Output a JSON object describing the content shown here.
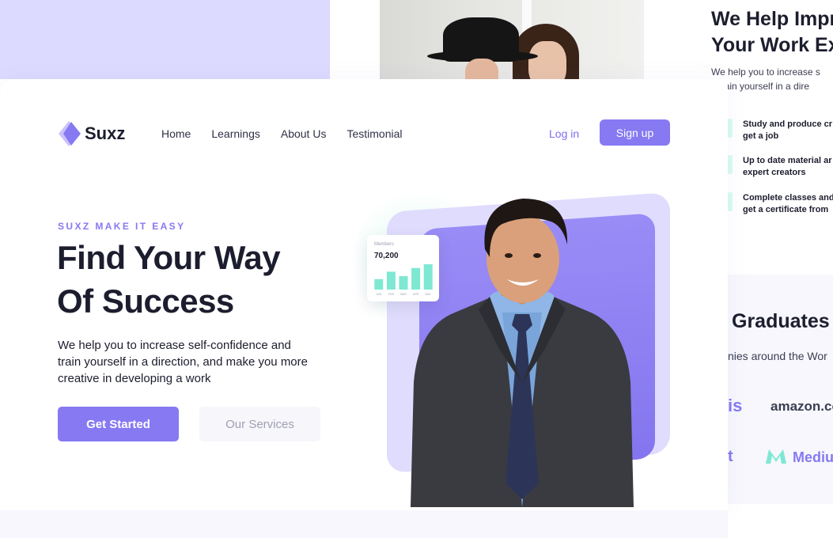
{
  "brand": {
    "name": "Suxz",
    "accent": "#8779f2",
    "mint": "#7ee8d2"
  },
  "nav": {
    "items": [
      {
        "label": "Home"
      },
      {
        "label": "Learnings"
      },
      {
        "label": "About Us"
      },
      {
        "label": "Testimonial"
      }
    ],
    "login_label": "Log in",
    "signup_label": "Sign up"
  },
  "hero": {
    "eyebrow": "SUXZ MAKE IT EASY",
    "headline": "Find Your Way\nOf Success",
    "description": "We help you to increase self-confidence and\ntrain yourself in a direction, and make you more\ncreative in developing a work",
    "primary_cta": "Get Started",
    "secondary_cta": "Our Services"
  },
  "stats_card": {
    "label": "Members",
    "value": "70,200",
    "chart_data": {
      "type": "bar",
      "categories": [
        "JAN",
        "FEB",
        "MAR",
        "APR",
        "MAY"
      ],
      "values": [
        14,
        24,
        18,
        29,
        34
      ],
      "color": "#7ee8d2"
    }
  },
  "right_page": {
    "title": "We Help Impr\nYour Work Exp",
    "description": "We help you to increase s\n’t train yourself in a dire",
    "features": [
      {
        "text": "Study and produce cr\nget a job"
      },
      {
        "text": "Up to date material ar\nexpert creators"
      },
      {
        "text": "Complete classes and\nget a certificate from"
      }
    ],
    "graduates_title": "Graduates",
    "graduates_subtitle": "nies around the Wor",
    "logos": [
      {
        "text": "is",
        "color": "#8779f2"
      },
      {
        "text": "amazon.co",
        "color": "#3b3d52"
      },
      {
        "text": "t",
        "color": "#8779f2"
      },
      {
        "text": "Mediu",
        "color": "#8779f2"
      }
    ]
  }
}
